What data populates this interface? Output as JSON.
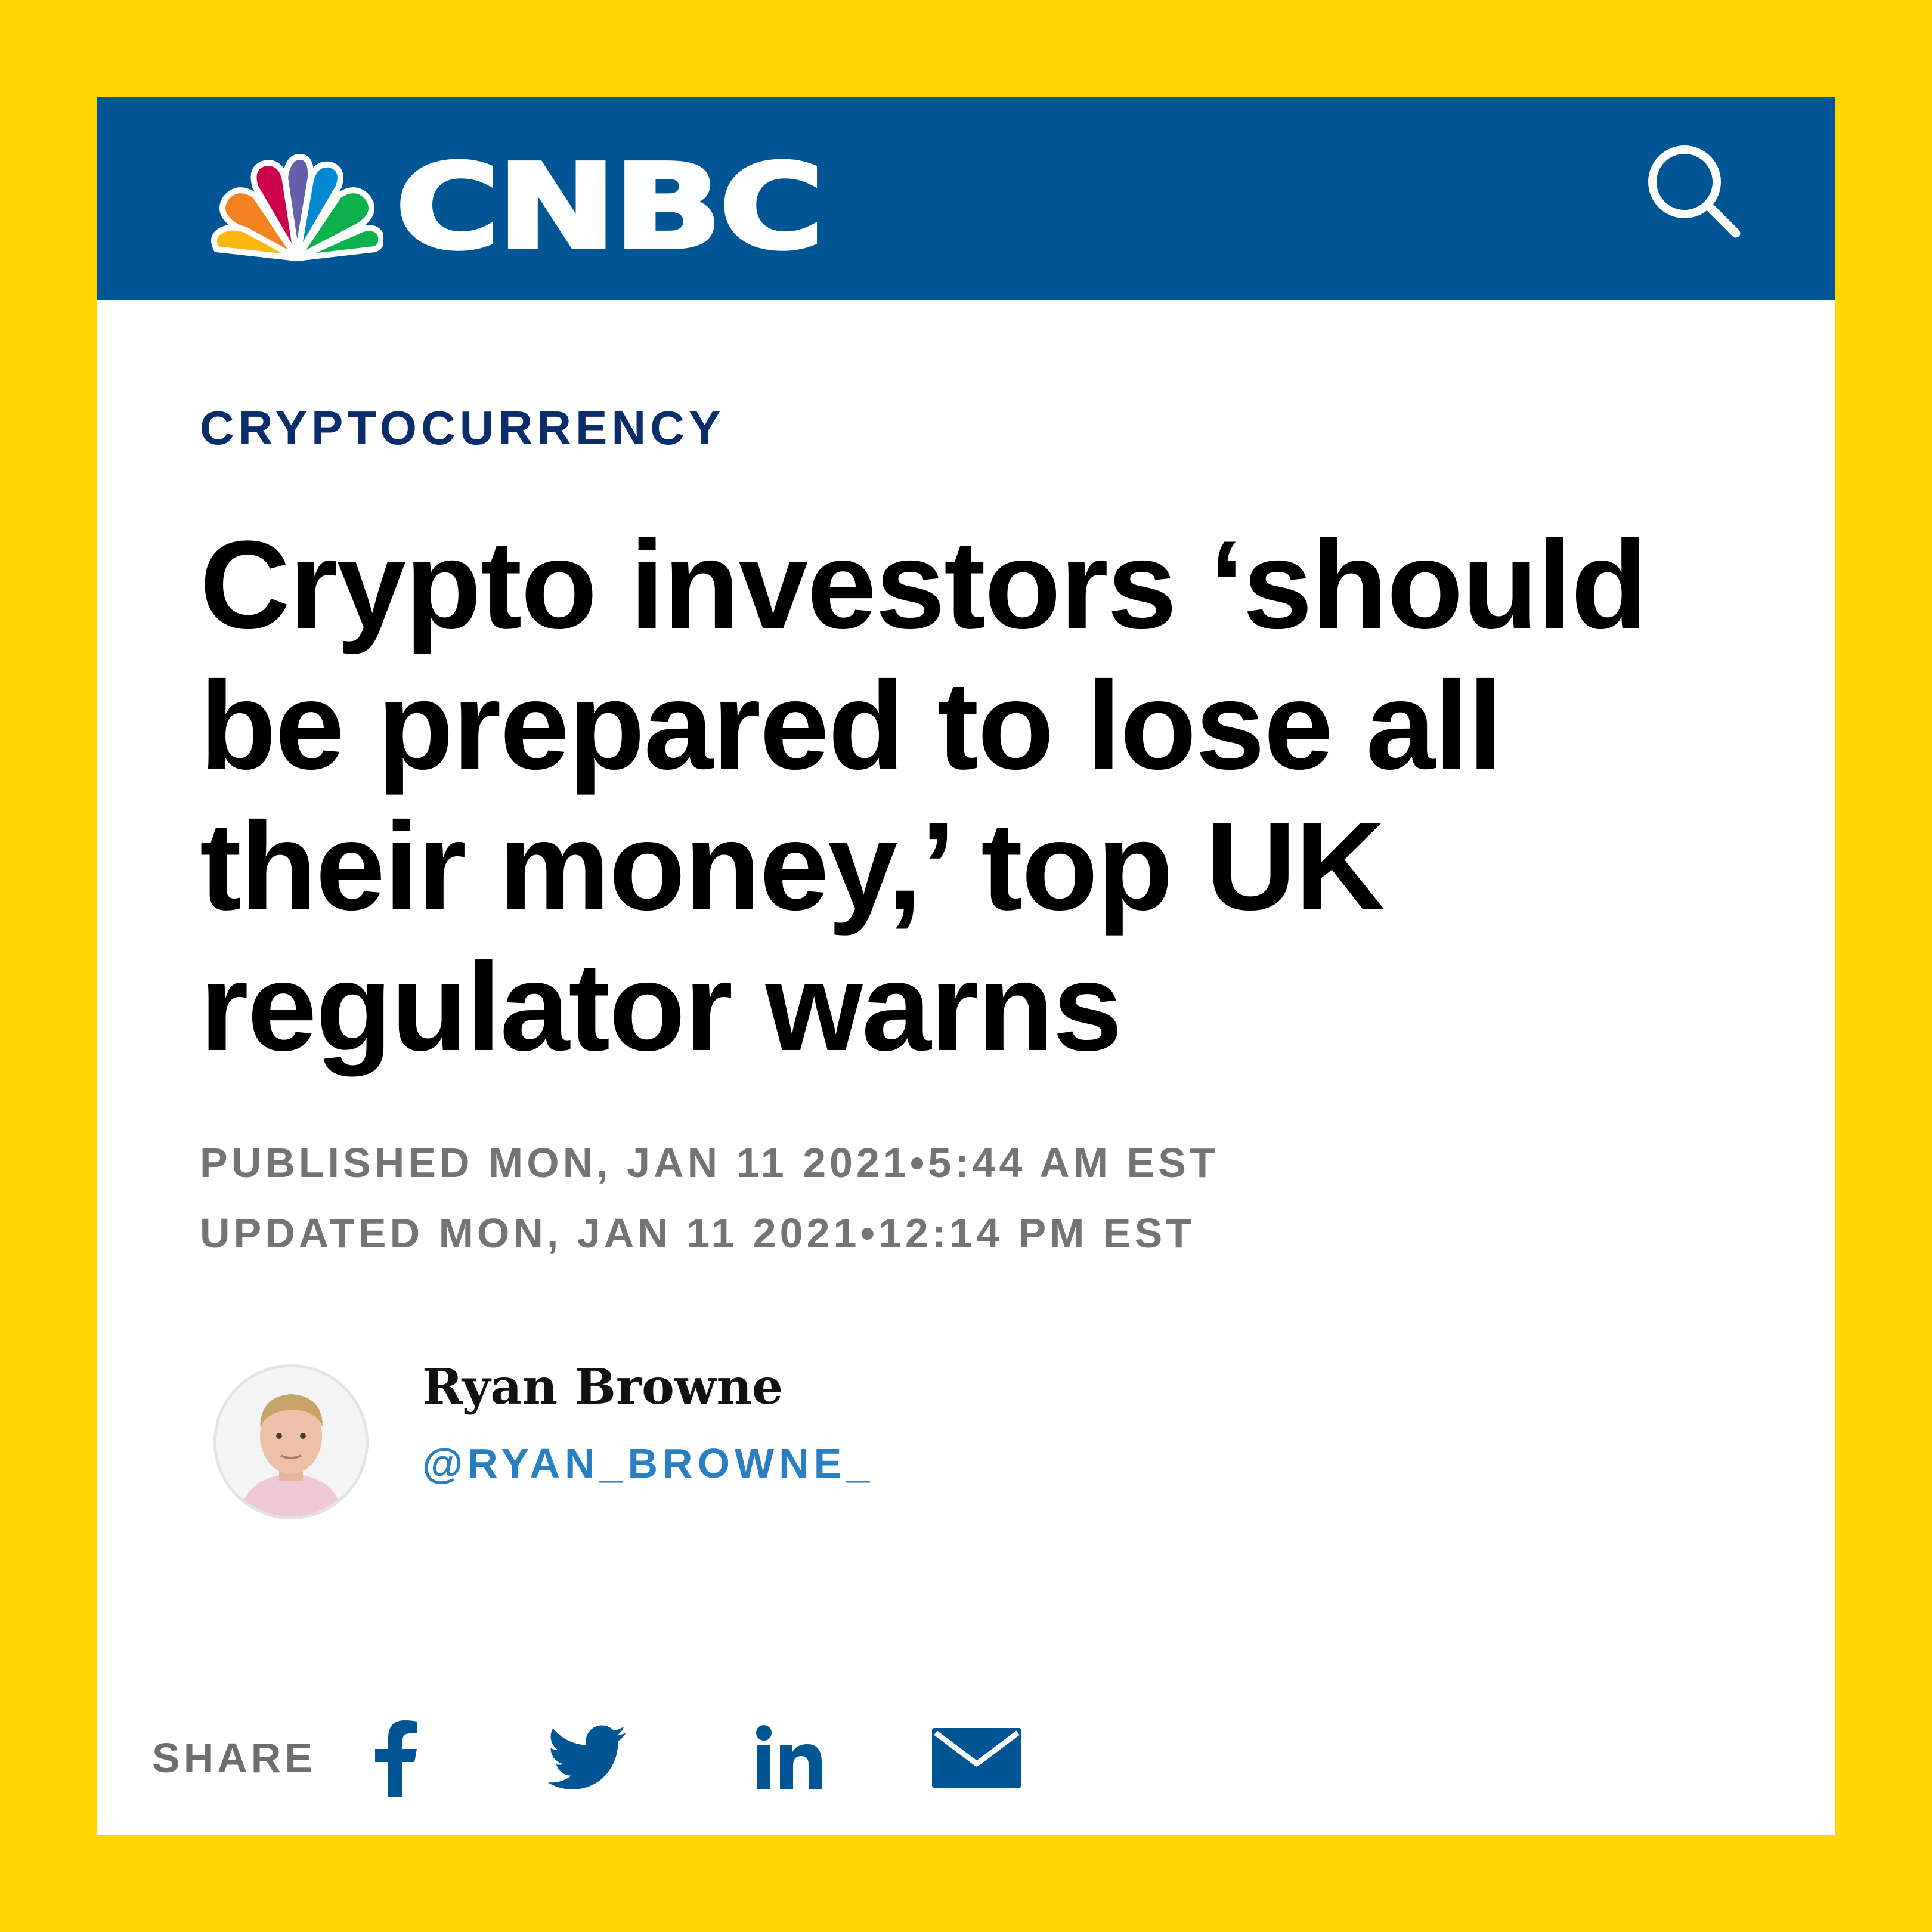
{
  "header": {
    "brand": "CNBC",
    "logo_icon": "nbc-peacock-icon",
    "search_icon": "search-icon",
    "background_color": "#005594"
  },
  "frame_color": "#FFD600",
  "article": {
    "section": "CRYPTOCURRENCY",
    "headline_lines": [
      "Crypto investors ‘should",
      "be prepared to lose all",
      "their money,’ top UK",
      "regulator warns"
    ],
    "published": "PUBLISHED MON, JAN 11 2021•5:44 AM EST",
    "updated": "UPDATED MON, JAN 11 2021•12:14 PM EST"
  },
  "author": {
    "name": "Ryan Browne",
    "handle": "@RYAN_BROWNE_",
    "avatar_icon": "author-photo"
  },
  "share": {
    "label": "SHARE",
    "buttons": [
      {
        "name": "facebook",
        "icon": "facebook-icon"
      },
      {
        "name": "twitter",
        "icon": "twitter-icon"
      },
      {
        "name": "linkedin",
        "icon": "linkedin-icon"
      },
      {
        "name": "email",
        "icon": "email-icon"
      }
    ],
    "icon_color": "#005594"
  }
}
